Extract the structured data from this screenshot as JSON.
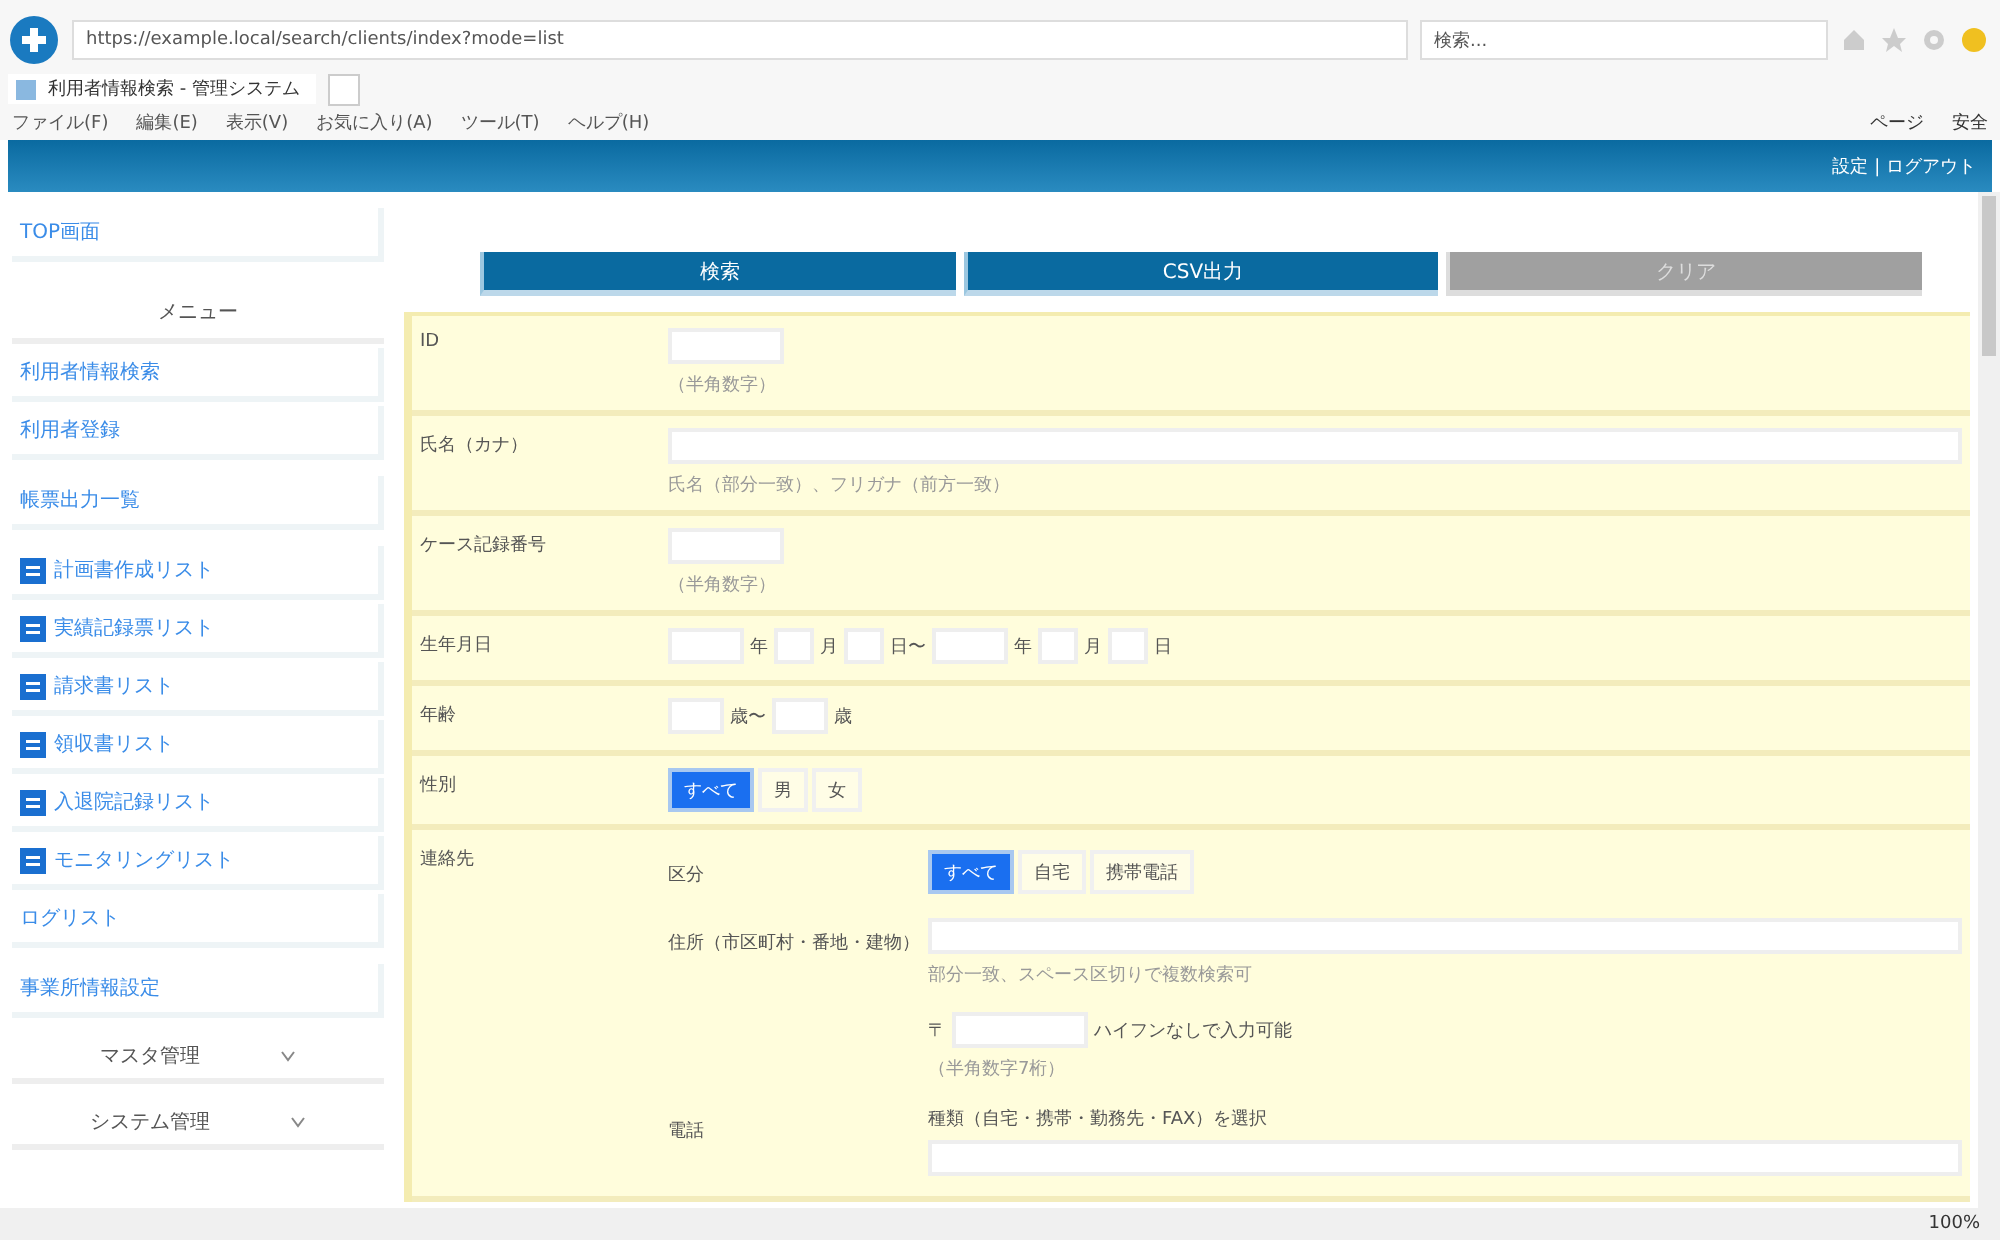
{
  "browser": {
    "address": "https://example.local/search/clients/index?mode=list",
    "search_placeholder": "検索...",
    "tab_title": "利用者情報検索 - 管理システム",
    "menu": [
      "ファイル(F)",
      "編集(E)",
      "表示(V)",
      "お気に入り(A)",
      "ツール(T)",
      "ヘルプ(H)"
    ],
    "tools": [
      "ページ",
      "安全"
    ],
    "zoom": "100%"
  },
  "header": {
    "links": "設定 | ログアウト"
  },
  "sidebar": {
    "sections": [
      {
        "items": [
          {
            "kind": "link",
            "label": "TOP画面"
          }
        ]
      },
      {
        "title": "メニュー",
        "items": [
          {
            "kind": "link",
            "label": "利用者情報検索"
          },
          {
            "kind": "link",
            "label": "利用者登録"
          }
        ]
      },
      {
        "items": [
          {
            "kind": "link",
            "label": "帳票出力一覧"
          }
        ]
      },
      {
        "items": [
          {
            "kind": "icon_link",
            "label": "計画書作成リスト"
          },
          {
            "kind": "icon_link",
            "label": "実績記録票リスト"
          },
          {
            "kind": "icon_link",
            "label": "請求書リスト"
          },
          {
            "kind": "icon_link",
            "label": "領収書リスト"
          },
          {
            "kind": "icon_link",
            "label": "入退院記録リスト"
          },
          {
            "kind": "icon_link",
            "label": "モニタリングリスト"
          },
          {
            "kind": "link",
            "label": "ログリスト"
          }
        ]
      },
      {
        "items": [
          {
            "kind": "link",
            "label": "事業所情報設定"
          }
        ]
      }
    ],
    "collapsibles": [
      {
        "label": "マスタ管理",
        "expanded": false
      },
      {
        "label": "システム管理",
        "expanded": false
      }
    ]
  },
  "actions": [
    {
      "label": "検索",
      "disabled": false
    },
    {
      "label": "CSV出力",
      "disabled": false
    },
    {
      "label": "クリア",
      "disabled": true
    }
  ],
  "form": [
    {
      "kind": "text",
      "label": "ID",
      "hint": "（半角数字）"
    },
    {
      "kind": "wide",
      "label": "氏名（カナ）",
      "hint": "氏名（部分一致）、フリガナ（前方一致）"
    },
    {
      "kind": "text",
      "label": "ケース記録番号",
      "hint": "（半角数字）"
    },
    {
      "kind": "date_range",
      "label": "生年月日",
      "parts": [
        {
          "unit": "年",
          "kind": "wide"
        },
        {
          "unit": "月",
          "kind": "narrow"
        },
        {
          "unit": "日〜",
          "kind": "narrow"
        },
        {
          "unit": "年",
          "kind": "wide"
        },
        {
          "unit": "月",
          "kind": "narrow"
        },
        {
          "unit": "日",
          "kind": "narrow"
        }
      ]
    },
    {
      "kind": "date_range",
      "label": "年齢",
      "parts": [
        {
          "unit": "歳〜",
          "kind": "medium"
        },
        {
          "unit": "歳",
          "kind": "medium"
        }
      ]
    },
    {
      "kind": "choice",
      "label": "性別",
      "options": [
        {
          "label": "すべて",
          "selected": true
        },
        {
          "label": "男",
          "selected": false
        },
        {
          "label": "女",
          "selected": false
        }
      ]
    },
    {
      "kind": "group",
      "label": "連絡先",
      "subrows": [
        {
          "kind": "choice",
          "label": "区分",
          "options": [
            {
              "label": "すべて",
              "selected": true
            },
            {
              "label": "自宅",
              "selected": false
            },
            {
              "label": "携帯電話",
              "selected": false
            }
          ]
        },
        {
          "kind": "wide",
          "label": "住所（市区町村・番地・建物）",
          "hint": "部分一致、スペース区切りで複数検索可"
        },
        {
          "kind": "postal",
          "prefix": "〒",
          "note": "ハイフンなしで入力可能",
          "hint": "（半角数字7桁）"
        },
        {
          "kind": "wide",
          "label": "電話",
          "note": "種類（自宅・携帯・勤務先・FAX）を選択"
        }
      ]
    }
  ]
}
